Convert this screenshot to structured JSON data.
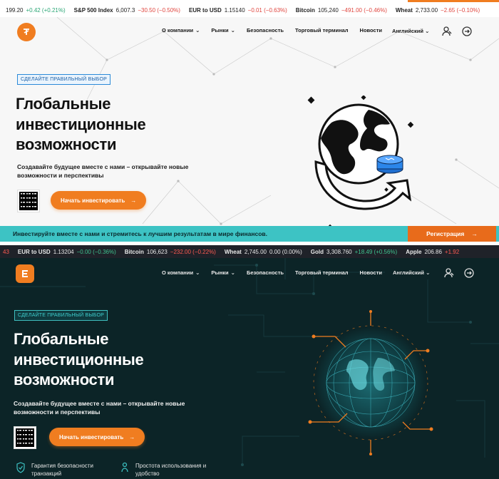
{
  "ticker_top": [
    {
      "name": "",
      "price": "199.20",
      "change": "+0.42 (+0.21%)",
      "dir": "up"
    },
    {
      "name": "S&P 500 Index",
      "price": "6,007.3",
      "change": "−30.50 (−0.50%)",
      "dir": "dn"
    },
    {
      "name": "EUR to USD",
      "price": "1.15140",
      "change": "−0.01 (−0.63%)",
      "dir": "dn"
    },
    {
      "name": "Bitcoin",
      "price": "105,240",
      "change": "−491.00 (−0.46%)",
      "dir": "dn"
    },
    {
      "name": "Wheat",
      "price": "2,733.00",
      "change": "−2.65 (−0.10%)",
      "dir": "dn"
    }
  ],
  "ticker_mid": [
    {
      "name": "",
      "price": "43",
      "change": "",
      "dir": "dn"
    },
    {
      "name": "EUR to USD",
      "price": "1.13204",
      "change": "−0.00 (−0.36%)",
      "dir": "up"
    },
    {
      "name": "Bitcoin",
      "price": "106,623",
      "change": "−232.00 (−0.22%)",
      "dir": "dn"
    },
    {
      "name": "Wheat",
      "price": "2,745.00",
      "change": "0.00 (0.00%)",
      "dir": "flat"
    },
    {
      "name": "Gold",
      "price": "3,308.760",
      "change": "+18.49 (+0.56%)",
      "dir": "up"
    },
    {
      "name": "Apple",
      "price": "206.86",
      "change": "+1.92",
      "dir": "dn"
    }
  ],
  "nav": {
    "about": "О компании",
    "markets": "Рынки",
    "security": "Безопасность",
    "terminal": "Торговый терминал",
    "news": "Новости",
    "lang": "Английский"
  },
  "hero": {
    "badge": "СДЕЛАЙТЕ ПРАВИЛЬНЫЙ ВЫБОР",
    "title_1": "Глобальные",
    "title_2": "инвестиционные",
    "title_3": "возможности",
    "sub_1": "Создавайте будущее вместе с нами – открывайте новые",
    "sub_2": "возможности и перспективы",
    "cta": "Начать инвестировать"
  },
  "strip": {
    "text": "Инвестируйте вместе с нами и стремитесь к лучшим результатам в мире финансов.",
    "register": "Регистрация"
  },
  "features": [
    {
      "line1": "Гарантия безопасности",
      "line2": "транзакций"
    },
    {
      "line1": "Простота использования и",
      "line2": "удобство"
    }
  ],
  "colors": {
    "accent": "#f07d20",
    "teal": "#3dc3c4",
    "dark_bg": "#0c2427"
  }
}
